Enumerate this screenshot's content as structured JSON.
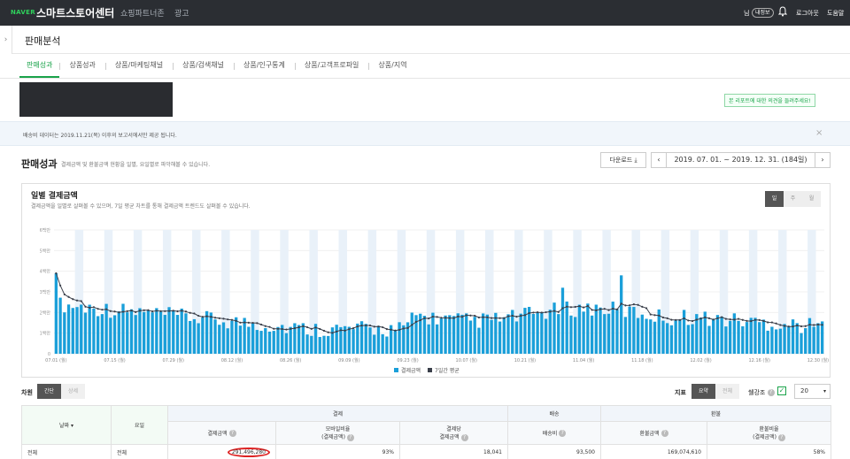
{
  "topbar": {
    "brand": "NAVER",
    "title": "스마트스토어센터",
    "nav": [
      "쇼핑파트너존",
      "광고"
    ],
    "user_suffix": "님",
    "user_badge": "내정보",
    "logout": "로그아웃",
    "help": "도움말"
  },
  "page": {
    "title": "판매분석",
    "sidebar_toggle": "›"
  },
  "tabs": [
    "판매성과",
    "상품성과",
    "상품/마케팅채널",
    "상품/검색채널",
    "상품/인구통계",
    "상품/고객프로파일",
    "상품/지역"
  ],
  "feedback_button": "본 리포트에 대한 의견을 들려주세요!",
  "notice": {
    "message": "배송비 데이터는 2019.11.21(목) 이후의 보고서에서만 제공 됩니다.",
    "close": "×"
  },
  "section": {
    "title": "판매성과",
    "desc": "결제금액 및 환불금액 현황을 일별, 요일별로 파악해볼 수 있습니다.",
    "download": "다운로드 ⤓",
    "date_range": "2019. 07. 01. ~ 2019. 12. 31. (184일)",
    "prev": "‹",
    "next": "›"
  },
  "chart_card": {
    "title": "일별 결제금액",
    "desc": "결제금액을 일별로 살펴볼 수 있으며, 7일 평균 차트를 통해 결제금액 트렌드도 살펴볼 수 있습니다.",
    "period_tabs": [
      "일",
      "주",
      "월"
    ]
  },
  "chart_data": {
    "type": "bar",
    "x_ticks": [
      "07.01 (월)",
      "07.15 (월)",
      "07.29 (월)",
      "08.12 (월)",
      "08.26 (월)",
      "09.09 (월)",
      "09.23 (월)",
      "10.07 (월)",
      "10.21 (월)",
      "11.04 (월)",
      "11.18 (월)",
      "12.02 (월)",
      "12.16 (월)",
      "12.30 (월)"
    ],
    "y_ticks": [
      "0",
      "1백만",
      "2백만",
      "3백만",
      "4백만",
      "5백만",
      "6백만"
    ],
    "ylim": [
      0,
      6000000
    ],
    "series": [
      {
        "name": "결제금액",
        "color": "#1a9fd9"
      },
      {
        "name": "7일간 평균",
        "color": "#3a3f4a"
      }
    ],
    "legend": "bottom-center",
    "weekend_shading": true
  },
  "controls": {
    "dimension_label": "차원",
    "dimension_options": [
      "간단",
      "상세"
    ],
    "metric_label": "지표",
    "metric_options": [
      "요약",
      "전체"
    ],
    "emphasis_label": "쉘강조",
    "checkbox": "✓",
    "help_glyph": "?",
    "rows_value": "20",
    "rows_caret": "▾"
  },
  "table": {
    "headers": {
      "date": "날짜 ▾",
      "weekday": "요일",
      "payment": "결제",
      "shipping": "배송",
      "refund": "환불"
    },
    "subheaders": {
      "pay_amount": "결제금액",
      "mobile_ratio": "모바일비율\n(결제금액)",
      "per_payment": "결제당\n결제금액",
      "ship_fee": "배송비",
      "refund_amount": "환불금액",
      "refund_ratio": "환불비율\n(결제금액)"
    },
    "row": {
      "date": "전체",
      "weekday": "전체",
      "pay_amount": "291,496,280",
      "mobile_ratio": "93%",
      "per_payment": "18,041",
      "ship_fee": "93,500",
      "refund_amount": "169,074,610",
      "refund_ratio": "58%"
    }
  }
}
